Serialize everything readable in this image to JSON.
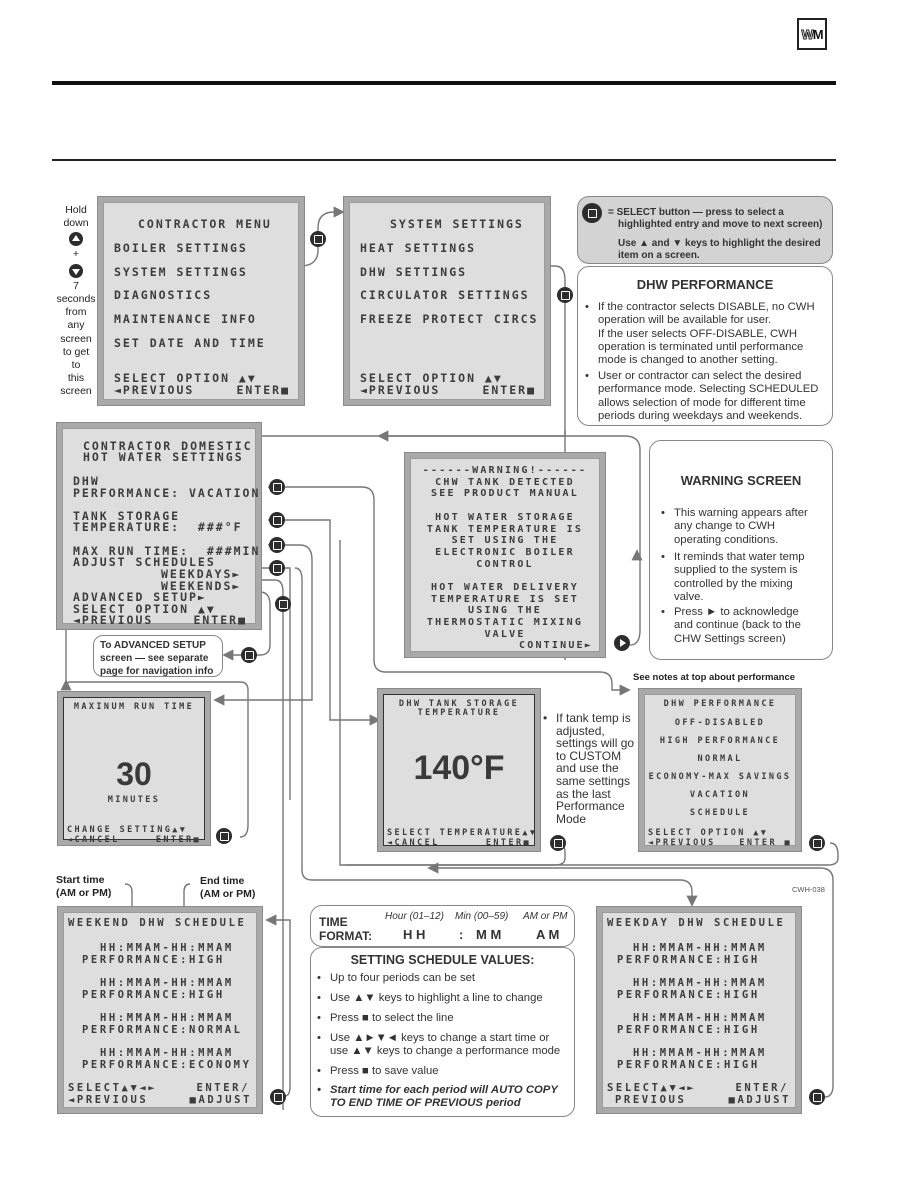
{
  "header": {
    "logo_left": "W",
    "logo_right": "M"
  },
  "side_label": [
    "Hold",
    "down",
    "+",
    "7",
    "seconds",
    "from",
    "any",
    "screen",
    "to get",
    "to",
    "this",
    "screen"
  ],
  "screens": {
    "contractor_menu": {
      "title": "CONTRACTOR MENU",
      "items": [
        "BOILER SETTINGS",
        "SYSTEM SETTINGS",
        "DIAGNOSTICS",
        "MAINTENANCE INFO",
        "SET DATE AND TIME"
      ],
      "footer1": "SELECT OPTION ▲▼",
      "previous": "◄PREVIOUS",
      "enter": "ENTER■"
    },
    "system_settings": {
      "title": "SYSTEM SETTINGS",
      "items": [
        "HEAT SETTINGS",
        "DHW SETTINGS",
        "CIRCULATOR SETTINGS",
        "FREEZE PROTECT CIRCS"
      ],
      "footer1": "SELECT OPTION ▲▼",
      "previous": "◄PREVIOUS",
      "enter": "ENTER■"
    },
    "dhw_settings": {
      "title1": "CONTRACTOR DOMESTIC",
      "title2": "HOT WATER SETTINGS",
      "perf1": "DHW",
      "perf2": "PERFORMANCE: VACATION",
      "tank1": "TANK STORAGE",
      "tank2": "TEMPERATURE:  ###°F",
      "maxrun": "MAX RUN TIME:  ###MIN",
      "adjust": "ADJUST SCHEDULES",
      "weekdays": "WEEKDAYS►",
      "weekends": "WEEKENDS►",
      "advanced": "ADVANCED SETUP►",
      "footer1": "SELECT OPTION ▲▼",
      "previous": "◄PREVIOUS",
      "enter": "ENTER■"
    },
    "warning": {
      "lines": [
        "------WARNING!------",
        "CHW TANK DETECTED",
        "SEE PRODUCT MANUAL",
        "",
        "HOT WATER STORAGE",
        "TANK TEMPERATURE IS",
        "SET USING THE",
        "ELECTRONIC BOILER",
        "CONTROL",
        "",
        "HOT WATER DELIVERY",
        "TEMPERATURE IS SET",
        "USING THE",
        "THERMOSTATIC MIXING",
        "VALVE"
      ],
      "continue": "CONTINUE►"
    },
    "max_run": {
      "title": "MAXINUM RUN TIME",
      "value": "30",
      "unit": "MINUTES",
      "footer1": "CHANGE SETTING▲▼",
      "cancel": "◄CANCEL",
      "enter": "ENTER■"
    },
    "tank_temp": {
      "title1": "DHW TANK STORAGE",
      "title2": "TEMPERATURE",
      "value": "140°F",
      "footer1": "SELECT TEMPERATURE▲▼",
      "cancel": "◄CANCEL",
      "enter": "ENTER■"
    },
    "dhw_performance": {
      "title": "DHW PERFORMANCE",
      "options": [
        "OFF-DISABLED",
        "HIGH PERFORMANCE",
        "NORMAL",
        "ECONOMY-MAX SAVINGS",
        "VACATION",
        "SCHEDULE"
      ],
      "footer1": "SELECT OPTION ▲▼",
      "previous": "◄PREVIOUS",
      "enter": "ENTER ■"
    },
    "weekend": {
      "title": "WEEKEND DHW SCHEDULE",
      "periods": [
        {
          "time": "HH:MMAM-HH:MMAM",
          "perf": "PERFORMANCE:HIGH"
        },
        {
          "time": "HH:MMAM-HH:MMAM",
          "perf": "PERFORMANCE:HIGH"
        },
        {
          "time": "HH:MMAM-HH:MMAM",
          "perf": "PERFORMANCE:NORMAL"
        },
        {
          "time": "HH:MMAM-HH:MMAM",
          "perf": "PERFORMANCE:ECONOMY"
        }
      ],
      "select": "SELECT▲▼◄►",
      "enter": "ENTER/",
      "previous": "◄PREVIOUS",
      "adjust": "■ADJUST"
    },
    "weekday": {
      "title": "WEEKDAY DHW SCHEDULE",
      "periods": [
        {
          "time": "HH:MMAM-HH:MMAM",
          "perf": "PERFORMANCE:HIGH"
        },
        {
          "time": "HH:MMAM-HH:MMAM",
          "perf": "PERFORMANCE:HIGH"
        },
        {
          "time": "HH:MMAM-HH:MMAM",
          "perf": "PERFORMANCE:HIGH"
        },
        {
          "time": "HH:MMAM-HH:MMAM",
          "perf": "PERFORMANCE:HIGH"
        }
      ],
      "select": "SELECT▲▼◄►",
      "enter": "ENTER/",
      "previous": "PREVIOUS",
      "adjust": "■ADJUST"
    }
  },
  "notes": {
    "select_button": {
      "line1": "=  SELECT button — press to  select a",
      "line2": "highlighted entry and move to next screen)",
      "line3": "Use ▲ and ▼ keys to highlight the desired",
      "line4": "item on a screen."
    },
    "dhw_performance": {
      "title": "DHW PERFORMANCE",
      "bullet1": [
        "If the contractor selects DISABLE, no CWH",
        "operation will be available for user.",
        "If the user selects OFF-DISABLE, CWH",
        "operation is terminated until  performance",
        "mode is changed to another setting."
      ],
      "bullet2": [
        "User or contractor can select the desired",
        "performance mode. Selecting SCHEDULED",
        "allows selection of mode for different time",
        "periods during weekdays and weekends."
      ]
    },
    "warning_screen": {
      "title": "WARNING SCREEN",
      "bullets": [
        [
          "This warning appears after",
          "any change to CWH",
          "operating conditions."
        ],
        [
          "It reminds that water temp",
          "supplied to the system is",
          "controlled by the mixing",
          "valve."
        ],
        [
          "Press ► to acknowledge",
          "and continue (back to the",
          "CHW Settings screen)"
        ]
      ]
    },
    "advanced": [
      "To ADVANCED SETUP",
      "screen — see separate",
      "page for navigation info"
    ],
    "tank_temp": [
      "If tank temp is",
      "adjusted,",
      "settings will go",
      "to CUSTOM",
      "and use the",
      "same settings",
      "as the last",
      "Performance",
      "Mode"
    ],
    "see_notes": "See notes at top about performance",
    "start_time": [
      "Start time",
      "(AM or PM)"
    ],
    "end_time": [
      "End time",
      "(AM or PM)"
    ],
    "time_format": {
      "label1": "TIME",
      "label2": "FORMAT:",
      "hour_hint": "Hour (01–12)",
      "min_hint": "Min (00–59)",
      "ampm_hint": "AM or PM",
      "hh": "H H",
      "colon": ":",
      "mm": "M M",
      "am": "A M"
    },
    "schedule_values": {
      "title": "SETTING SCHEDULE VALUES:",
      "bullets": [
        [
          "Up to four periods can be set"
        ],
        [
          "Use ▲▼ keys to highlight a line to change"
        ],
        [
          "Press ■ to select the line"
        ],
        [
          "Use ▲►▼◄ keys to change a start time or",
          "use ▲▼ keys to change a performance mode"
        ],
        [
          "Press ■ to save value"
        ],
        [
          "Start time for each period will AUTO COPY",
          "TO END TIME OF PREVIOUS period"
        ]
      ]
    }
  },
  "figure_code": "CWH-038"
}
